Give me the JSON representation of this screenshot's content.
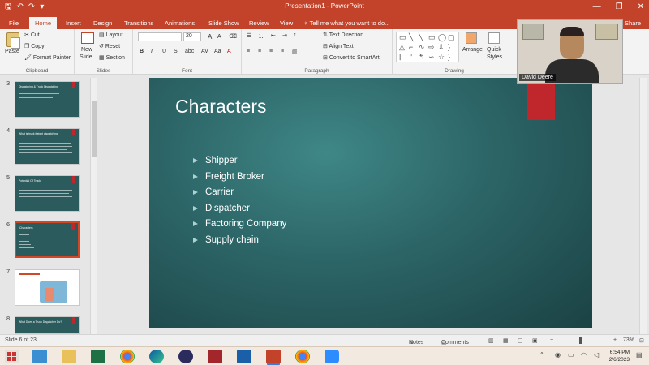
{
  "titlebar": {
    "title": "Presentation1 - PowerPoint",
    "qat": [
      "save-icon",
      "undo-icon",
      "redo-icon",
      "customize-icon"
    ],
    "window_controls": [
      "minimize-icon",
      "restore-icon",
      "close-icon"
    ],
    "glyphs": {
      "save": "🖫",
      "undo": "↶",
      "redo": "↷",
      "customize": "▾",
      "minimize": "—",
      "restore": "❐",
      "close": "✕"
    }
  },
  "tabs": [
    {
      "label": "File",
      "active": false
    },
    {
      "label": "Home",
      "active": true
    },
    {
      "label": "Insert",
      "active": false
    },
    {
      "label": "Design",
      "active": false
    },
    {
      "label": "Transitions",
      "active": false
    },
    {
      "label": "Animations",
      "active": false
    },
    {
      "label": "Slide Show",
      "active": false
    },
    {
      "label": "Review",
      "active": false
    },
    {
      "label": "View",
      "active": false
    }
  ],
  "tell_me": "Tell me what you want to do...",
  "share": "Share",
  "ribbon": {
    "clipboard": {
      "paste": "Paste",
      "cut": "Cut",
      "copy": "Copy",
      "format_painter": "Format Painter",
      "label": "Clipboard"
    },
    "slides": {
      "new_slide": "New",
      "new_slide2": "Slide",
      "layout": "Layout",
      "reset": "Reset",
      "section": "Section",
      "label": "Slides"
    },
    "font": {
      "font_name": "",
      "font_size": "20",
      "label": "Font",
      "bold": "B",
      "italic": "I",
      "underline": "U",
      "strike": "S",
      "grow": "A",
      "shrink": "A"
    },
    "paragraph": {
      "text_direction": "Text Direction",
      "align_text": "Align Text",
      "convert_smartart": "Convert to SmartArt",
      "label": "Paragraph"
    },
    "drawing": {
      "arrange": "Arrange",
      "quick_styles": "Quick",
      "quick_styles2": "Styles",
      "label": "Drawing"
    }
  },
  "thumbnails": [
    {
      "num": "3",
      "title": "Dispatching & Truck Dispatching",
      "selected": false,
      "style": "dark"
    },
    {
      "num": "4",
      "title": "What is truck freight dispatching",
      "selected": false,
      "style": "dark"
    },
    {
      "num": "5",
      "title": "Potential Of Truck",
      "selected": false,
      "style": "dark"
    },
    {
      "num": "6",
      "title": "Characters",
      "selected": true,
      "style": "dark"
    },
    {
      "num": "7",
      "title": "",
      "selected": false,
      "style": "white"
    },
    {
      "num": "8",
      "title": "What Does a Truck Dispatcher Do?",
      "selected": false,
      "style": "dark"
    }
  ],
  "slide": {
    "title": "Characters",
    "bullets": [
      "Shipper",
      "Freight Broker",
      "Carrier",
      "Dispatcher",
      "Factoring Company",
      "Supply chain"
    ]
  },
  "video": {
    "participant_name": "David Deere"
  },
  "statusbar": {
    "slide_counter": "Slide 6 of 23",
    "notes": "Notes",
    "comments": "Comments",
    "zoom": "73%",
    "zoom_value": 73
  },
  "taskbar": {
    "time": "6:54 PM",
    "date": "2/6/2023",
    "apps": [
      "windows-start",
      "edge-legacy",
      "file-explorer",
      "excel",
      "chrome",
      "edge",
      "teams",
      "cube-app",
      "shield-app",
      "powerpoint",
      "chrome-profile",
      "zoom"
    ]
  },
  "colors": {
    "accent": "#c2432a",
    "slide_bg": "#2c6466",
    "red_bar": "#c0272d",
    "bullet": "#a9d2d2"
  }
}
